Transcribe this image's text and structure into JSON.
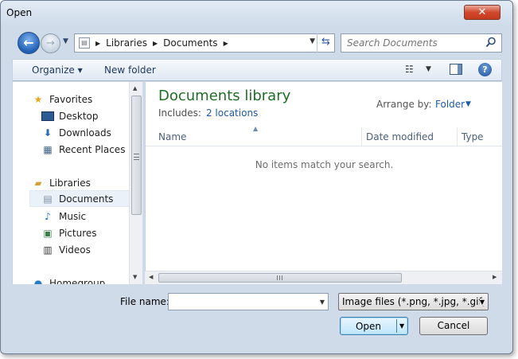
{
  "window": {
    "title": "Open",
    "close_glyph": "✕"
  },
  "nav": {
    "back_glyph": "←",
    "forward_glyph": "→",
    "breadcrumbs": [
      "Libraries",
      "Documents"
    ],
    "search_placeholder": "Search Documents"
  },
  "toolbar": {
    "organize_label": "Organize ▾",
    "new_folder_label": "New folder",
    "help_glyph": "?"
  },
  "sidebar": {
    "items": [
      {
        "label": "Favorites",
        "icon": "star-icon"
      },
      {
        "label": "Desktop",
        "icon": "desktop-icon"
      },
      {
        "label": "Downloads",
        "icon": "downloads-icon"
      },
      {
        "label": "Recent Places",
        "icon": "recent-places-icon"
      },
      {
        "label": "Libraries",
        "icon": "libraries-icon"
      },
      {
        "label": "Documents",
        "icon": "documents-icon",
        "selected": true
      },
      {
        "label": "Music",
        "icon": "music-icon"
      },
      {
        "label": "Pictures",
        "icon": "pictures-icon"
      },
      {
        "label": "Videos",
        "icon": "videos-icon"
      },
      {
        "label": "Homegroup",
        "icon": "homegroup-icon"
      }
    ]
  },
  "main": {
    "library_title": "Documents library",
    "includes_label": "Includes:",
    "locations_link": "2 locations",
    "arrange_by_label": "Arrange by:",
    "arrange_by_value": "Folder",
    "columns": [
      "Name",
      "Date modified",
      "Type"
    ],
    "empty_message": "No items match your search."
  },
  "footer": {
    "file_name_label": "File name:",
    "file_name_value": "",
    "file_type": "Image files (*.png, *.jpg, *.gif, *",
    "open_label": "Open",
    "cancel_label": "Cancel"
  },
  "colors": {
    "library_title": "#1e6e26",
    "link": "#1d5ba8",
    "close_button": "#c43a1f"
  }
}
